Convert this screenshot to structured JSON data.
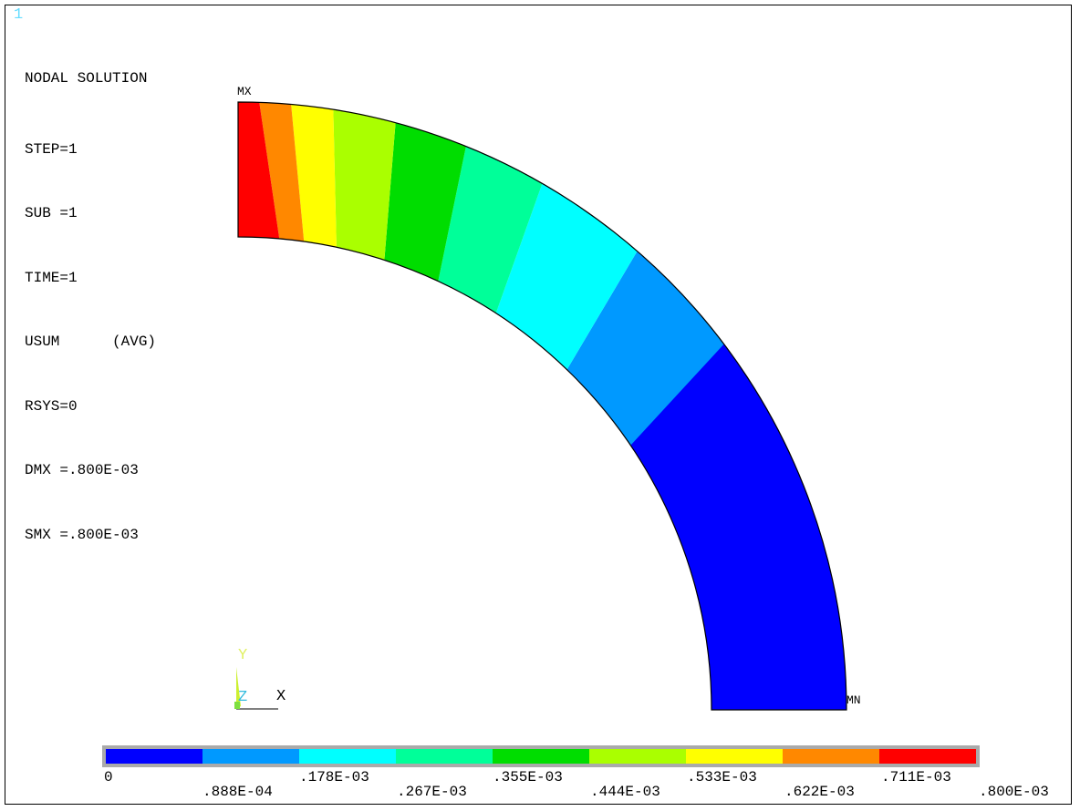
{
  "window_number": "1",
  "info": {
    "title": "NODAL SOLUTION",
    "lines": [
      "STEP=1",
      "SUB =1",
      "TIME=1",
      "USUM      (AVG)",
      "RSYS=0",
      "DMX =.800E-03",
      "SMX =.800E-03"
    ]
  },
  "markers": {
    "max": "MX",
    "min": "MN"
  },
  "triad": {
    "y": "Y",
    "z": "Z",
    "x": "X"
  },
  "contour_colors": [
    "#0000ff",
    "#0099ff",
    "#00ffff",
    "#00ff99",
    "#00dd00",
    "#aaff00",
    "#ffff00",
    "#ff8800",
    "#ff0000"
  ],
  "legend": {
    "values_top": [
      "0",
      ".178E-03",
      ".355E-03",
      ".533E-03",
      ".711E-03"
    ],
    "values_bottom": [
      ".888E-04",
      ".267E-03",
      ".444E-03",
      ".622E-03",
      ".800E-03"
    ]
  }
}
